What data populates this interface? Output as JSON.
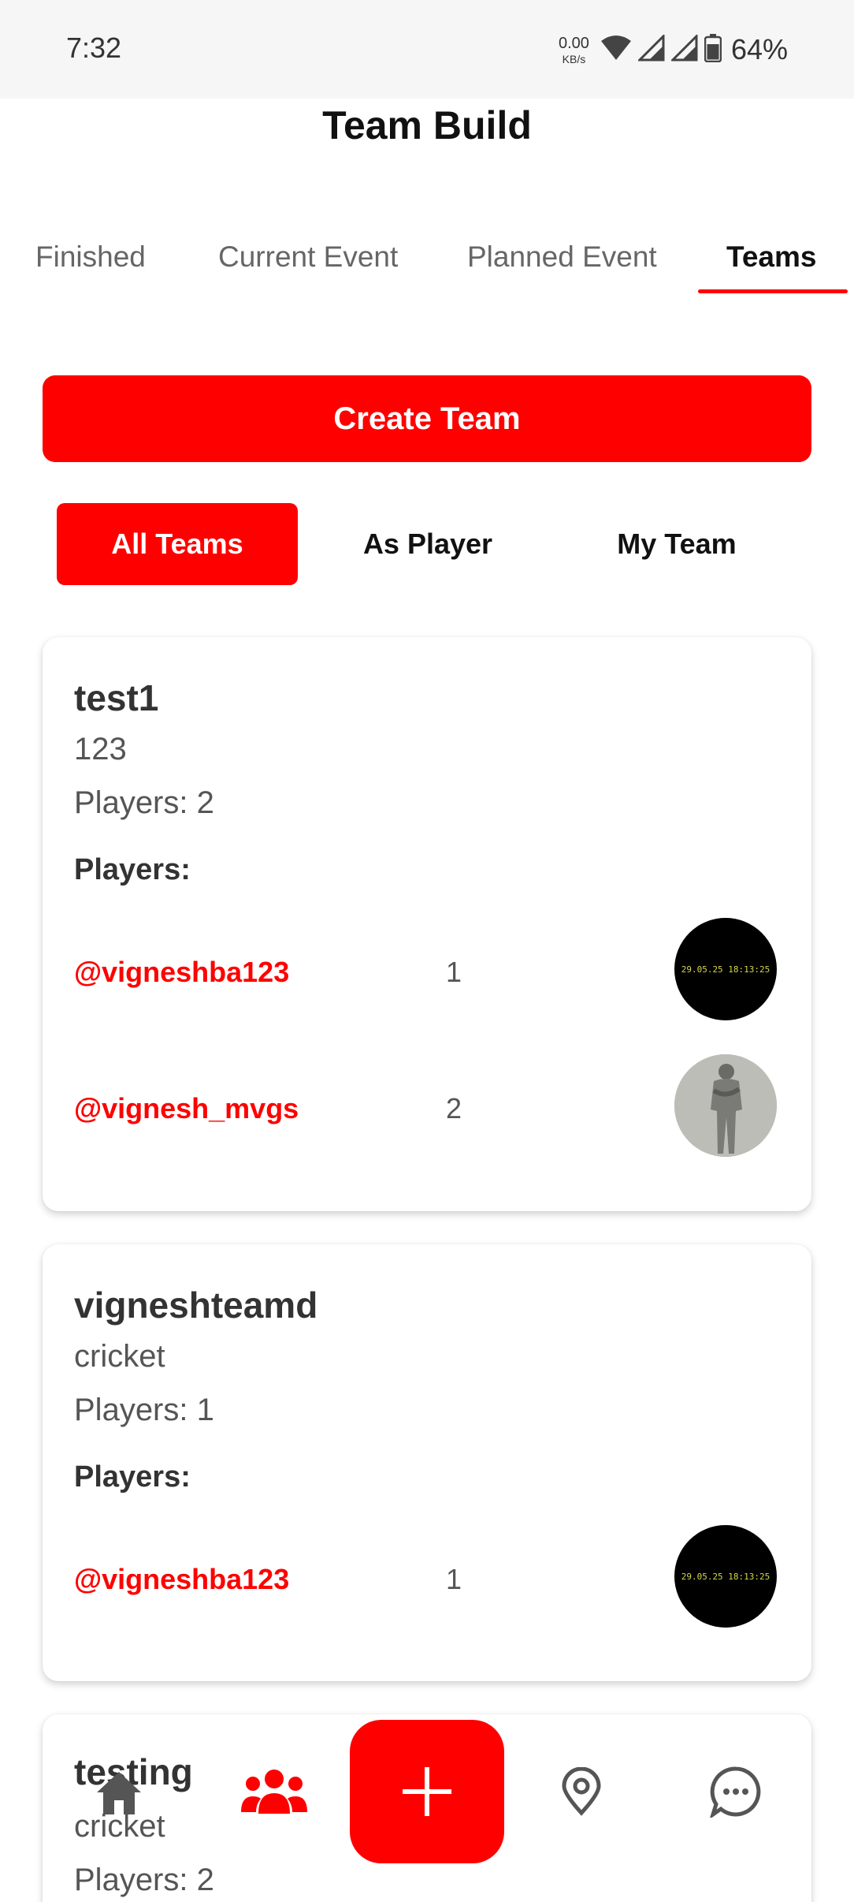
{
  "status_bar": {
    "time": "7:32",
    "net_speed_value": "0.00",
    "net_speed_unit": "KB/s",
    "battery": "64%"
  },
  "header": {
    "title": "Team Build"
  },
  "tabs": [
    {
      "label": "Finished",
      "active": false
    },
    {
      "label": "Current Event",
      "active": false
    },
    {
      "label": "Planned Event",
      "active": false
    },
    {
      "label": "Teams",
      "active": true
    }
  ],
  "create_team_label": "Create Team",
  "filters": [
    {
      "label": "All Teams",
      "active": true
    },
    {
      "label": "As Player",
      "active": false
    },
    {
      "label": "My Team",
      "active": false
    }
  ],
  "teams": [
    {
      "name": "test1",
      "description": "123",
      "player_count": "Players: 2",
      "players_heading": "Players:",
      "players": [
        {
          "handle": "@vigneshba123",
          "number": "1",
          "avatar_text": "29.05.25 18:13:25"
        },
        {
          "handle": "@vignesh_mvgs",
          "number": "2"
        }
      ]
    },
    {
      "name": "vigneshteamd",
      "description": "cricket",
      "player_count": "Players: 1",
      "players_heading": "Players:",
      "players": [
        {
          "handle": "@vigneshba123",
          "number": "1",
          "avatar_text": "29.05.25 18:13:25"
        }
      ]
    },
    {
      "name": "testing",
      "description": "cricket",
      "player_count": "Players: 2"
    }
  ],
  "bottom_nav": {
    "items": [
      "home-icon",
      "teams-icon",
      "add-icon",
      "location-icon",
      "chat-icon"
    ],
    "active_color": "#ff0000",
    "inactive_color": "#555555"
  },
  "colors": {
    "accent": "#ff0000",
    "status_bar_bg": "#f6f6f6"
  }
}
